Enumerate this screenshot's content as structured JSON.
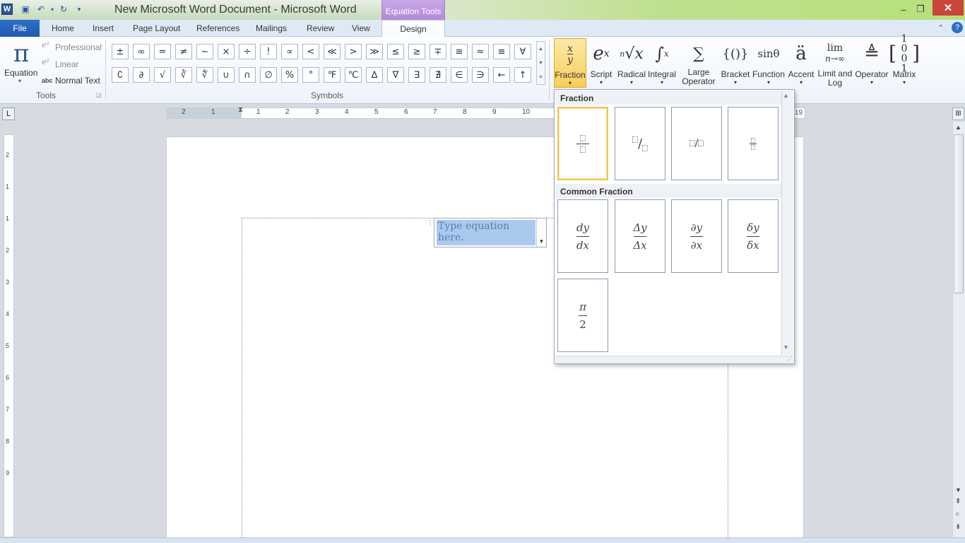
{
  "window": {
    "app_icon": "W",
    "title": "New Microsoft Word Document  -  Microsoft Word",
    "context_tab_group": "Equation Tools",
    "controls": {
      "minimize": "–",
      "restore": "❐",
      "close": "✕"
    }
  },
  "tabs": {
    "file": "File",
    "items": [
      "Home",
      "Insert",
      "Page Layout",
      "References",
      "Mailings",
      "Review",
      "View"
    ],
    "active": "Design"
  },
  "ribbon": {
    "tools": {
      "equation_label": "Equation",
      "equation_glyph": "π",
      "professional": "Professional",
      "linear": "Linear",
      "normal_text": "Normal Text",
      "normal_text_prefix": "abc",
      "group_label": "Tools"
    },
    "symbols": {
      "row1": [
        "±",
        "∞",
        "=",
        "≠",
        "~",
        "×",
        "÷",
        "!",
        "∝",
        "<",
        "≪",
        ">",
        "≫",
        "≤",
        "≥",
        "∓",
        "≅",
        "≈",
        "≡",
        "∀"
      ],
      "row2": [
        "∁",
        "∂",
        "√",
        "∛",
        "∜",
        "∪",
        "∩",
        "∅",
        "%",
        "°",
        "℉",
        "℃",
        "∆",
        "∇",
        "∃",
        "∄",
        "∈",
        "∋",
        "←",
        "↑"
      ],
      "group_label": "Symbols"
    },
    "structures": [
      {
        "label": "Fraction",
        "glyph": "x/y"
      },
      {
        "label": "Script",
        "glyph": "eˣ"
      },
      {
        "label": "Radical",
        "glyph": "ⁿ√x"
      },
      {
        "label": "Integral",
        "glyph": "∫"
      },
      {
        "label": "Large Operator",
        "glyph": "∑"
      },
      {
        "label": "Bracket",
        "glyph": "{()}"
      },
      {
        "label": "Function",
        "glyph": "sinθ"
      },
      {
        "label": "Accent",
        "glyph": "ä"
      },
      {
        "label": "Limit and Log",
        "glyph": "lim"
      },
      {
        "label": "Operator",
        "glyph": "≜"
      },
      {
        "label": "Matrix",
        "glyph": "[10;01]"
      }
    ]
  },
  "ruler": {
    "ticks": [
      "2",
      "1",
      "1",
      "2",
      "3",
      "4",
      "5",
      "6",
      "7",
      "8",
      "9",
      "10"
    ],
    "right_tick": "19",
    "vertical_ticks": [
      "2",
      "1",
      "1",
      "2",
      "3",
      "4",
      "5",
      "6",
      "7",
      "8",
      "9"
    ]
  },
  "document": {
    "equation_placeholder": "Type equation here."
  },
  "fraction_gallery": {
    "section1_title": "Fraction",
    "section2_title": "Common Fraction",
    "common": [
      {
        "num": "dy",
        "den": "dx"
      },
      {
        "num": "Δy",
        "den": "Δx"
      },
      {
        "num": "∂y",
        "den": "∂x"
      },
      {
        "num": "δy",
        "den": "δx"
      },
      {
        "num": "π",
        "den": "2"
      }
    ]
  },
  "colors": {
    "file_tab": "#1f5aad",
    "context_tab": "#b48ad8",
    "selection": "#a9c9ee",
    "close_button": "#c9463d"
  }
}
